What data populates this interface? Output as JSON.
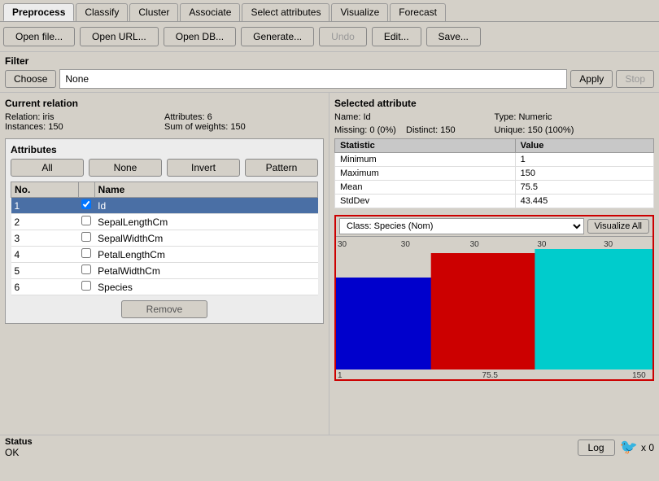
{
  "tabs": [
    {
      "label": "Preprocess",
      "active": true
    },
    {
      "label": "Classify",
      "active": false
    },
    {
      "label": "Cluster",
      "active": false
    },
    {
      "label": "Associate",
      "active": false
    },
    {
      "label": "Select attributes",
      "active": false
    },
    {
      "label": "Visualize",
      "active": false
    },
    {
      "label": "Forecast",
      "active": false
    }
  ],
  "toolbar": {
    "open_file": "Open file...",
    "open_url": "Open URL...",
    "open_db": "Open DB...",
    "generate": "Generate...",
    "undo": "Undo",
    "edit": "Edit...",
    "save": "Save..."
  },
  "filter": {
    "label": "Filter",
    "choose_btn": "Choose",
    "value": "None",
    "apply_btn": "Apply",
    "stop_btn": "Stop"
  },
  "current_relation": {
    "title": "Current relation",
    "relation_label": "Relation:",
    "relation_value": "iris",
    "instances_label": "Instances:",
    "instances_value": "150",
    "attributes_label": "Attributes:",
    "attributes_value": "6",
    "sum_label": "Sum of weights:",
    "sum_value": "150"
  },
  "attributes": {
    "title": "Attributes",
    "buttons": [
      "All",
      "None",
      "Invert",
      "Pattern"
    ],
    "col_no": "No.",
    "col_name": "Name",
    "rows": [
      {
        "no": 1,
        "name": "Id",
        "selected": true
      },
      {
        "no": 2,
        "name": "SepalLengthCm",
        "selected": false
      },
      {
        "no": 3,
        "name": "SepalWidthCm",
        "selected": false
      },
      {
        "no": 4,
        "name": "PetalLengthCm",
        "selected": false
      },
      {
        "no": 5,
        "name": "PetalWidthCm",
        "selected": false
      },
      {
        "no": 6,
        "name": "Species",
        "selected": false
      }
    ],
    "remove_btn": "Remove"
  },
  "selected_attribute": {
    "title": "Selected attribute",
    "name_label": "Name:",
    "name_value": "Id",
    "missing_label": "Missing:",
    "missing_value": "0 (0%)",
    "distinct_label": "Distinct:",
    "distinct_value": "150",
    "type_label": "Type:",
    "type_value": "Numeric",
    "unique_label": "Unique:",
    "unique_value": "150 (100%)",
    "stats": {
      "col_statistic": "Statistic",
      "col_value": "Value",
      "rows": [
        {
          "stat": "Minimum",
          "val": "1"
        },
        {
          "stat": "Maximum",
          "val": "150"
        },
        {
          "stat": "Mean",
          "val": "75.5"
        },
        {
          "stat": "StdDev",
          "val": "43.445"
        }
      ]
    }
  },
  "visualization": {
    "class_label": "Class: Species (Nom)",
    "visualize_all_btn": "Visualize All",
    "bar_labels": [
      "30",
      "30",
      "30",
      "30",
      "30"
    ],
    "x_labels": [
      "1",
      "75.5",
      "150"
    ],
    "colors": [
      "#0000cc",
      "#cc0000",
      "#00cccc"
    ],
    "bars": [
      {
        "color": "#0000cc",
        "x_pct": 0,
        "w_pct": 33,
        "h_pct": 80,
        "y_pct": 20
      },
      {
        "color": "#cc0000",
        "x_pct": 30,
        "w_pct": 36,
        "h_pct": 95,
        "y_pct": 5
      },
      {
        "color": "#00cccc",
        "x_pct": 62,
        "w_pct": 38,
        "h_pct": 100,
        "y_pct": 0
      }
    ]
  },
  "status": {
    "label": "Status",
    "ok_text": "OK",
    "log_btn": "Log",
    "x0_label": "x 0"
  }
}
